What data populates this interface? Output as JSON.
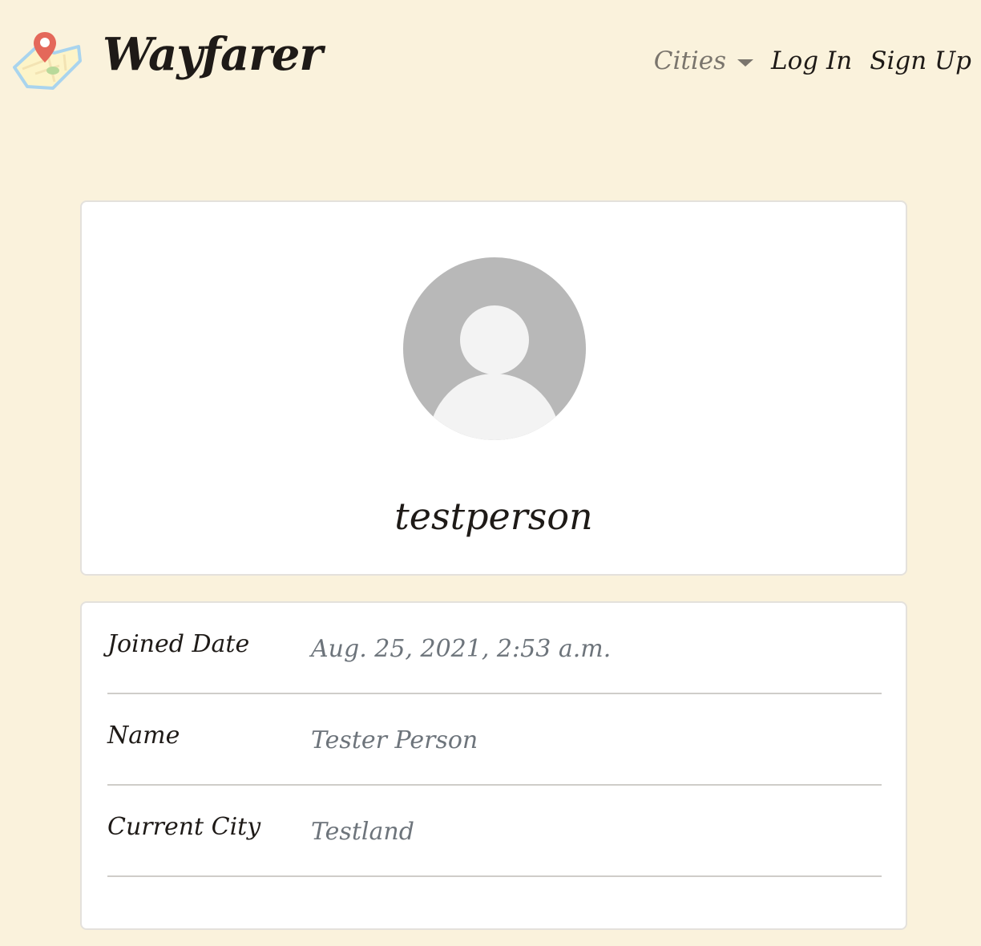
{
  "header": {
    "brand": "Wayfarer",
    "nav": {
      "cities_label": "Cities",
      "login_label": "Log In",
      "signup_label": "Sign Up"
    }
  },
  "profile": {
    "username": "testperson",
    "avatar_icon": "default-user-avatar-icon"
  },
  "details": {
    "rows": [
      {
        "label": "Joined Date",
        "value": "Aug. 25, 2021, 2:53 a.m."
      },
      {
        "label": "Name",
        "value": "Tester Person"
      },
      {
        "label": "Current City",
        "value": "Testland"
      }
    ]
  },
  "colors": {
    "background": "#faf2dc",
    "card": "#ffffff",
    "text": "#1e1a17",
    "muted_text": "#6d747b",
    "avatar_gray": "#b8b8b8",
    "pin_red": "#e4685a",
    "map_blue": "#a9d4ee"
  }
}
